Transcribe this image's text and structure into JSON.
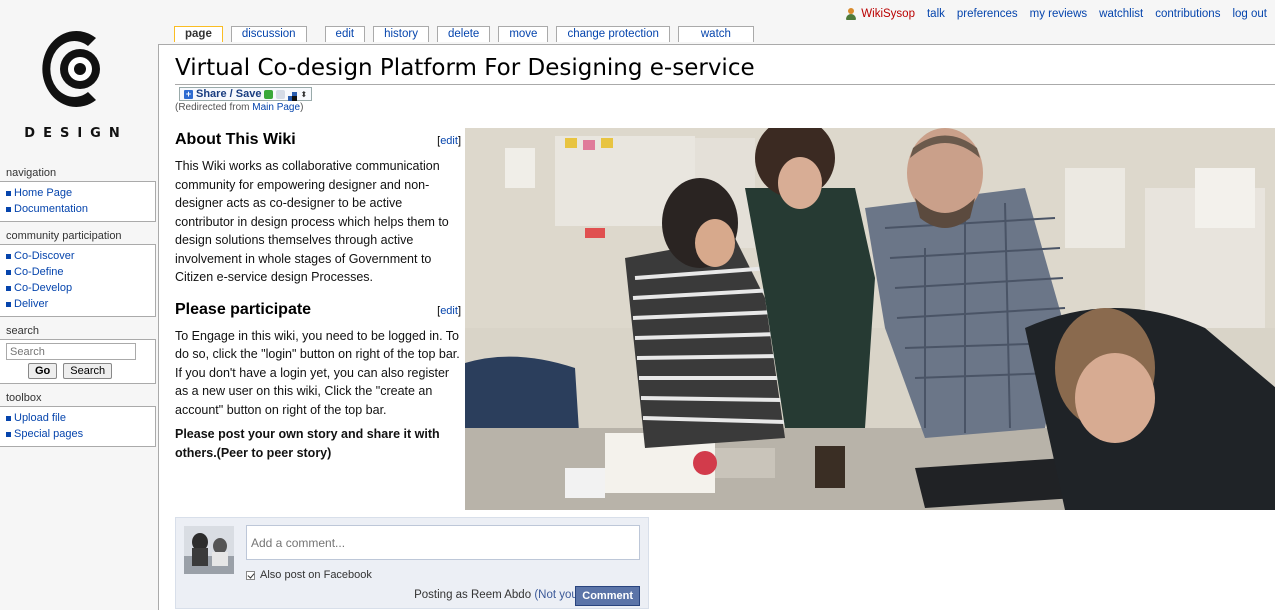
{
  "personal": {
    "user": "WikiSysop",
    "links": [
      "talk",
      "preferences",
      "my reviews",
      "watchlist",
      "contributions",
      "log out"
    ]
  },
  "logo": {
    "wordmark": "DESIGN"
  },
  "tabs": [
    {
      "label": "page",
      "selected": true
    },
    {
      "label": "discussion"
    },
    {
      "label": "edit"
    },
    {
      "label": "history"
    },
    {
      "label": "delete"
    },
    {
      "label": "move"
    },
    {
      "label": "change protection"
    },
    {
      "label": "watch"
    }
  ],
  "sidebar": {
    "navigation": {
      "title": "navigation",
      "items": [
        "Home Page",
        "Documentation"
      ]
    },
    "community": {
      "title": "community participation",
      "items": [
        "Co-Discover",
        "Co-Define",
        "Co-Develop",
        "Deliver"
      ]
    },
    "search": {
      "title": "search",
      "placeholder": "Search",
      "go": "Go",
      "search": "Search"
    },
    "toolbox": {
      "title": "toolbox",
      "items": [
        "Upload file",
        "Special pages"
      ]
    }
  },
  "page": {
    "title": "Virtual Co-design Platform For Designing e-service",
    "share_label": "Share / Save",
    "redirect_prefix": "(Redirected from ",
    "redirect_link": "Main Page",
    "redirect_suffix": ")",
    "edit_open": "[",
    "edit_label": "edit",
    "edit_close": "]",
    "about": {
      "heading": "About This Wiki",
      "text": "This Wiki works as collaborative communication community for empowering designer and non-designer acts as co-designer to be active contributor in design process which helps them to design solutions themselves through active involvement in whole stages of Government to Citizen e-service design Processes."
    },
    "participate": {
      "heading": "Please participate",
      "text": "To Engage in this wiki, you need to be logged in. To do so, click the \"login\" button on right of the top bar. If you don't have a login yet, you can also register as a new user on this wiki, Click the \"create an account\" button on right of the top bar.",
      "bold_text": "Please post your own story and share it with others.(Peer to peer story)"
    }
  },
  "comments": {
    "placeholder": "Add a comment...",
    "also_post": "Also post on Facebook",
    "posting_as": "Posting as Reem Abdo",
    "not_you": "(Not you?)",
    "button": "Comment"
  },
  "colors": {
    "link": "#0645ad",
    "user": "#ba0000",
    "fb_button": "#5b74a8"
  }
}
